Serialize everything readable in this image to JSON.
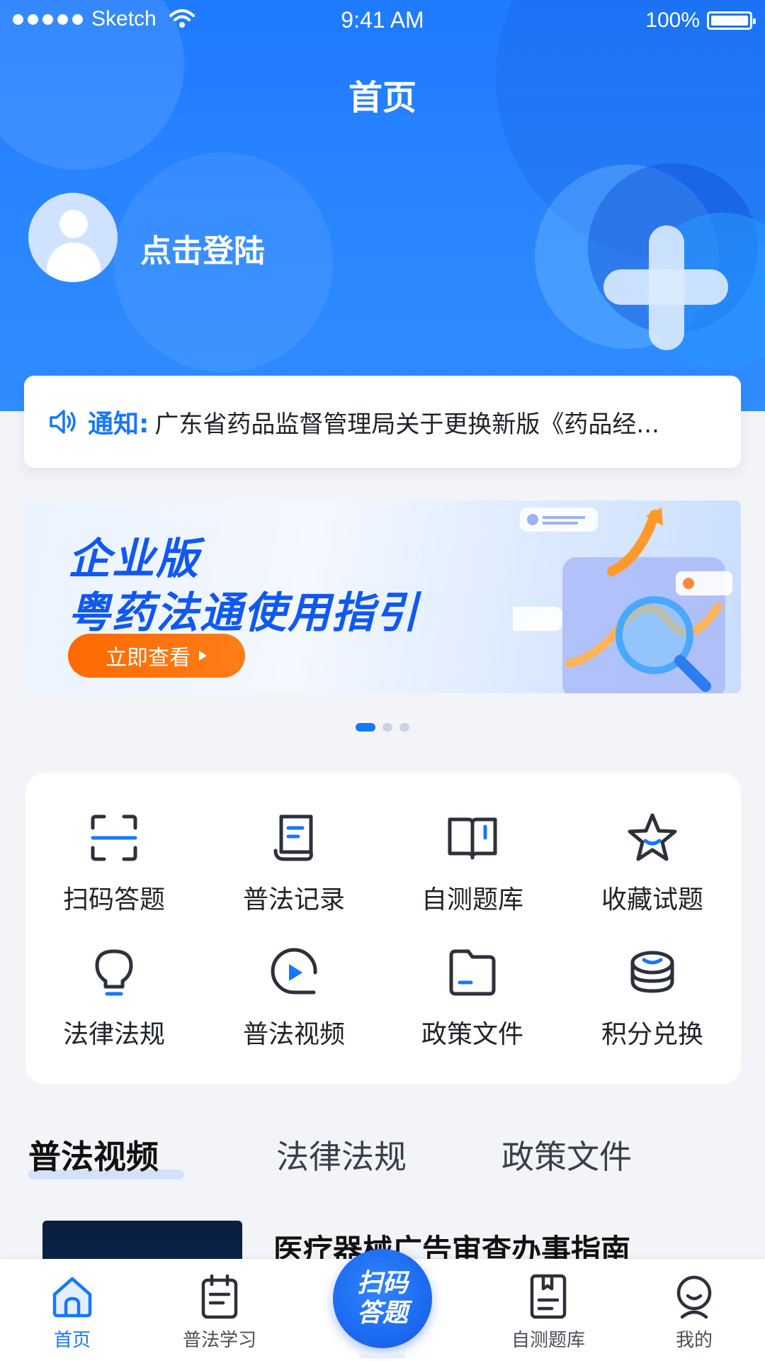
{
  "status_bar": {
    "carrier": "Sketch",
    "time": "9:41 AM",
    "battery": "100%"
  },
  "header": {
    "title": "首页",
    "login_label": "点击登陆"
  },
  "notice": {
    "label": "通知:",
    "text": "广东省药品监督管理局关于更换新版《药品经..."
  },
  "banner": {
    "line1": "企业版",
    "line2": "粤药法通使用指引",
    "cta": "立即查看",
    "slides": 3,
    "active_slide": 1
  },
  "grid": [
    {
      "label": "扫码答题",
      "icon": "scan-icon"
    },
    {
      "label": "普法记录",
      "icon": "scroll-record-icon"
    },
    {
      "label": "自测题库",
      "icon": "open-book-icon"
    },
    {
      "label": "收藏试题",
      "icon": "star-icon"
    },
    {
      "label": "法律法规",
      "icon": "lightbulb-icon"
    },
    {
      "label": "普法视频",
      "icon": "play-icon"
    },
    {
      "label": "政策文件",
      "icon": "folder-icon"
    },
    {
      "label": "积分兑换",
      "icon": "coins-icon"
    }
  ],
  "section_tabs": [
    {
      "label": "普法视频",
      "active": true
    },
    {
      "label": "法律法规",
      "active": false
    },
    {
      "label": "政策文件",
      "active": false
    }
  ],
  "article": {
    "title": "医疗器械广告审查办事指南"
  },
  "bottom_nav": {
    "items": [
      {
        "label": "首页",
        "icon": "home-icon",
        "active": true
      },
      {
        "label": "普法学习",
        "icon": "notebook-icon",
        "active": false
      },
      {
        "label": "自测题库",
        "icon": "question-bank-icon",
        "active": false
      },
      {
        "label": "我的",
        "icon": "profile-icon",
        "active": false
      }
    ],
    "fab": {
      "line1": "扫码",
      "line2": "答题"
    }
  },
  "colors": {
    "primary": "#1677ff",
    "accent_orange": "#ff6a00",
    "background": "#f2f4f8"
  }
}
